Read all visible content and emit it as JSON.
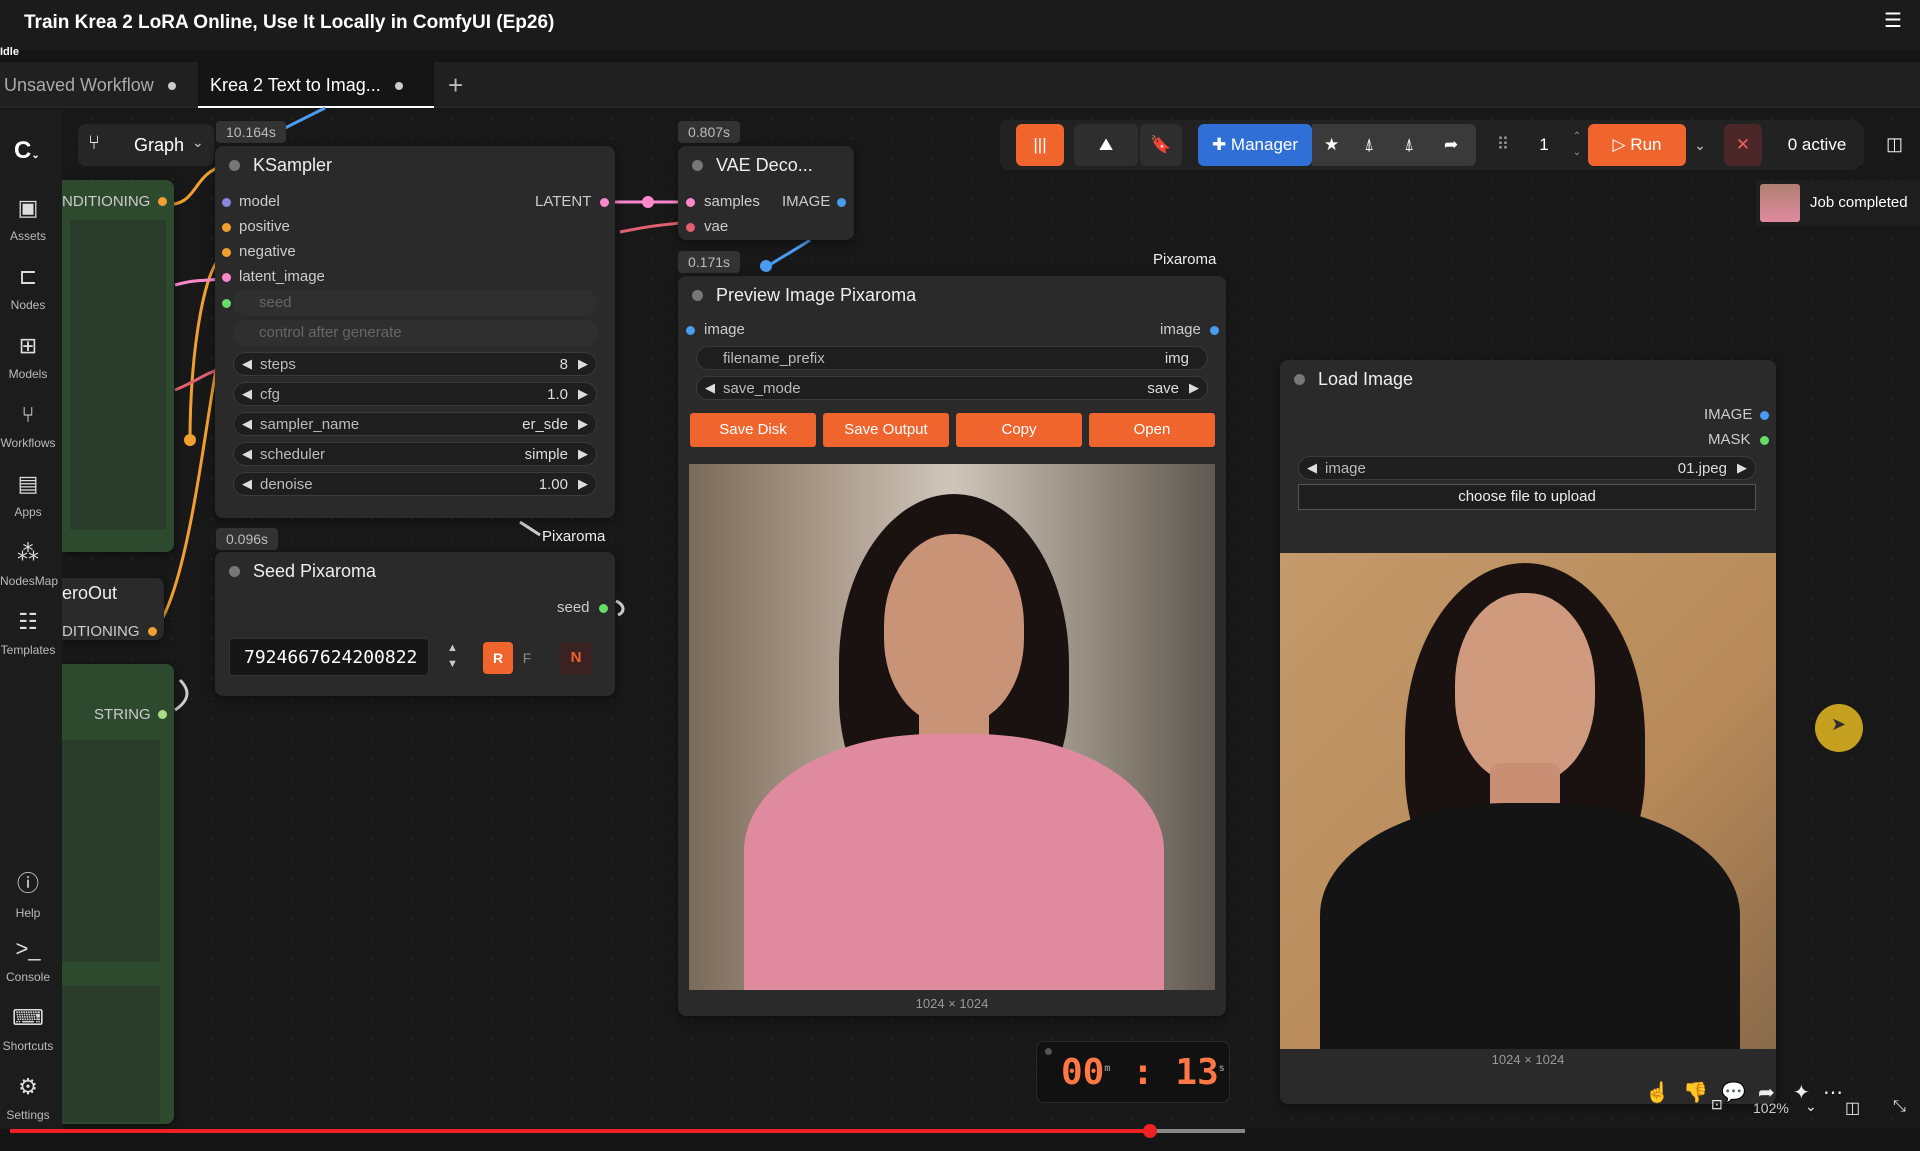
{
  "window": {
    "title": "Train Krea 2 LoRA Online, Use It Locally in ComfyUI (Ep26)",
    "status": "Idle"
  },
  "tabs": [
    {
      "label": "Unsaved Workflow"
    },
    {
      "label": "Krea 2 Text to Imag..."
    }
  ],
  "sidebar": {
    "items": [
      {
        "label": "Assets",
        "icon": "assets-icon"
      },
      {
        "label": "Nodes",
        "icon": "nodes-icon"
      },
      {
        "label": "Models",
        "icon": "models-icon"
      },
      {
        "label": "Workflows",
        "icon": "workflows-icon"
      },
      {
        "label": "Apps",
        "icon": "apps-icon"
      },
      {
        "label": "NodesMap",
        "icon": "nodesmap-icon"
      },
      {
        "label": "Templates",
        "icon": "templates-icon"
      },
      {
        "label": "Help",
        "icon": "help-icon"
      },
      {
        "label": "Console",
        "icon": "console-icon"
      },
      {
        "label": "Shortcuts",
        "icon": "shortcuts-icon"
      },
      {
        "label": "Settings",
        "icon": "settings-icon"
      }
    ]
  },
  "graph_button": "Graph",
  "toolbar": {
    "manager_label": "Manager",
    "queue_count": "1",
    "run_label": "Run",
    "active_label": "0 active",
    "job_status": "Job completed"
  },
  "left_partial": {
    "conditioning1": "NDITIONING",
    "zeroout": "eroOut",
    "conditioning2": "DITIONING",
    "string": "STRING"
  },
  "ksampler": {
    "time": "10.164s",
    "title": "KSampler",
    "inputs": [
      "model",
      "positive",
      "negative",
      "latent_image"
    ],
    "output": "LATENT",
    "seed_label": "seed",
    "control_label": "control after generate",
    "widgets": [
      {
        "label": "steps",
        "value": "8"
      },
      {
        "label": "cfg",
        "value": "1.0"
      },
      {
        "label": "sampler_name",
        "value": "er_sde"
      },
      {
        "label": "scheduler",
        "value": "simple"
      },
      {
        "label": "denoise",
        "value": "1.00"
      }
    ]
  },
  "vae": {
    "time": "0.807s",
    "title": "VAE Deco...",
    "inputs": [
      "samples",
      "vae"
    ],
    "output": "IMAGE"
  },
  "seed_node": {
    "time": "0.096s",
    "group": "Pixaroma",
    "title": "Seed Pixaroma",
    "output": "seed",
    "value": "7924667624200822",
    "btn_r": "R",
    "btn_f": "F",
    "btn_n": "N"
  },
  "preview": {
    "time": "0.171s",
    "group": "Pixaroma",
    "title": "Preview Image Pixaroma",
    "input": "image",
    "output": "image",
    "filename_label": "filename_prefix",
    "filename_value": "img",
    "save_mode_label": "save_mode",
    "save_mode_value": "save",
    "buttons": [
      "Save Disk",
      "Save Output",
      "Copy",
      "Open"
    ],
    "size": "1024 × 1024"
  },
  "load_image": {
    "title": "Load Image",
    "outputs": [
      "IMAGE",
      "MASK"
    ],
    "image_label": "image",
    "image_value": "01.jpeg",
    "upload_label": "choose file to upload",
    "size": "1024 × 1024"
  },
  "timer": {
    "minutes": "00",
    "seconds": "13",
    "m": "m",
    "s": "s"
  },
  "zoom": "102%",
  "colors": {
    "accent": "#f0642d",
    "manager": "#2f6fd6",
    "progress": "#e22222"
  }
}
